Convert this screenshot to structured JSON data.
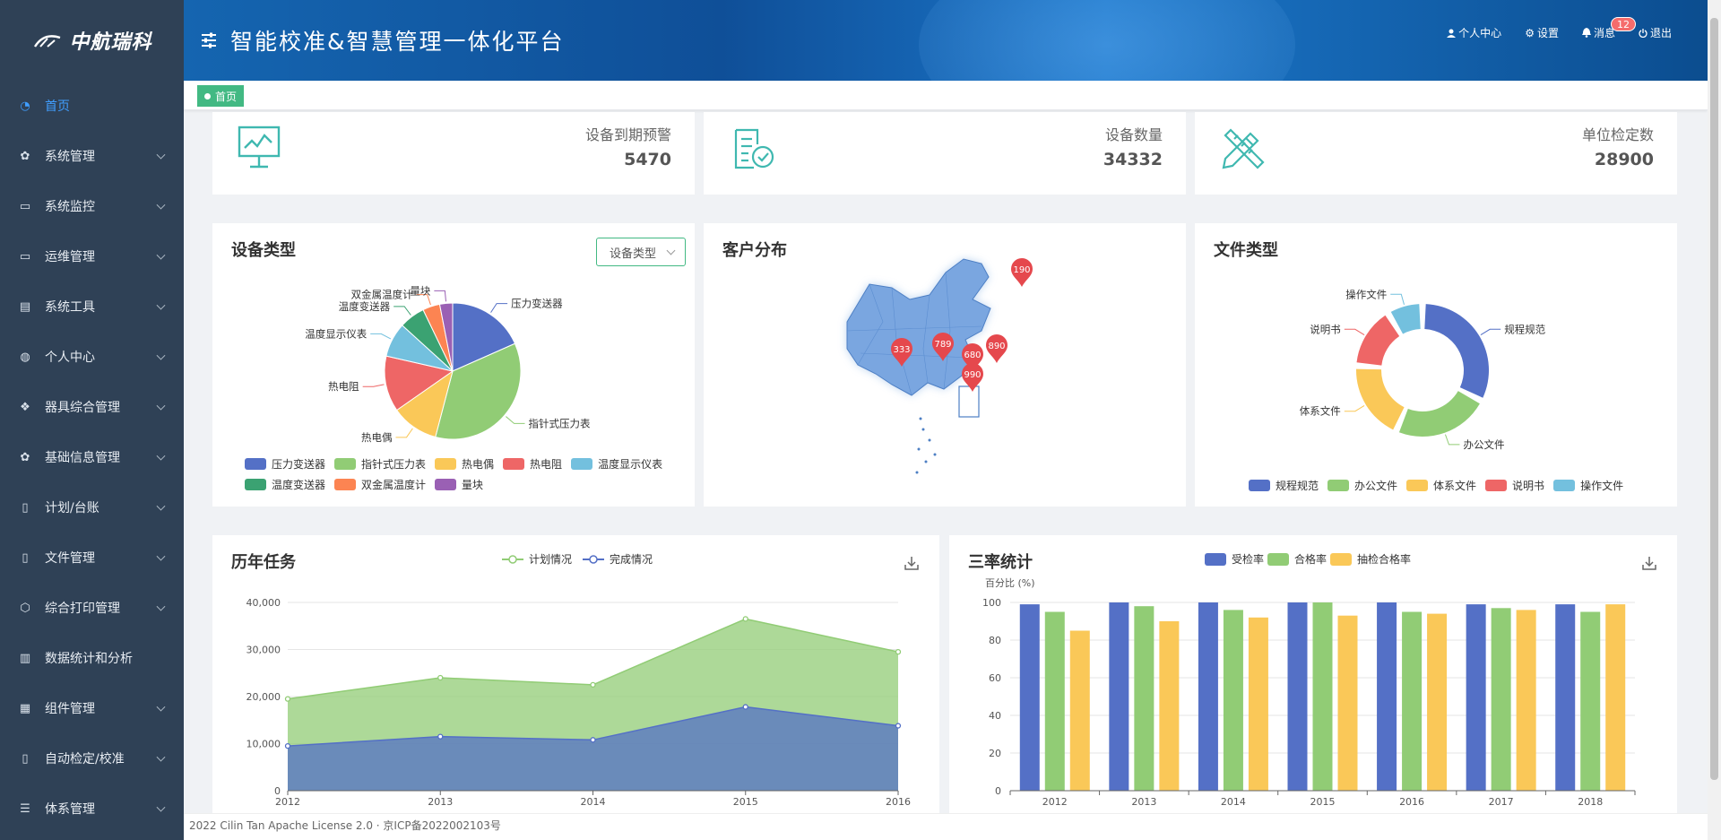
{
  "app": {
    "logo_text": "中航瑞科",
    "title": "智能校准&智慧管理一体化平台"
  },
  "toolbar": {
    "profile": "个人中心",
    "settings": "设置",
    "messages": "消息",
    "message_count": "12",
    "logout": "退出"
  },
  "tags": {
    "home": "首页"
  },
  "sidebar": {
    "items": [
      {
        "label": "首页",
        "icon": "dashboard-icon",
        "active": true
      },
      {
        "label": "系统管理",
        "icon": "gear-icon"
      },
      {
        "label": "系统监控",
        "icon": "monitor-icon"
      },
      {
        "label": "运维管理",
        "icon": "screen-icon"
      },
      {
        "label": "系统工具",
        "icon": "toolbox-icon"
      },
      {
        "label": "个人中心",
        "icon": "user-icon"
      },
      {
        "label": "器具综合管理",
        "icon": "grid-icon"
      },
      {
        "label": "基础信息管理",
        "icon": "gear-icon"
      },
      {
        "label": "计划/台账",
        "icon": "book-icon"
      },
      {
        "label": "文件管理",
        "icon": "book-icon"
      },
      {
        "label": "综合打印管理",
        "icon": "cube-icon"
      },
      {
        "label": "数据统计和分析",
        "icon": "bar-chart-icon"
      },
      {
        "label": "组件管理",
        "icon": "widgets-icon"
      },
      {
        "label": "自动检定/校准",
        "icon": "book-icon"
      },
      {
        "label": "体系管理",
        "icon": "list-icon"
      }
    ]
  },
  "stats": [
    {
      "label": "设备到期预警",
      "value": "5470",
      "icon": "monitor-chart-icon"
    },
    {
      "label": "设备数量",
      "value": "34332",
      "icon": "clipboard-check-icon"
    },
    {
      "label": "单位检定数",
      "value": "28900",
      "icon": "pencil-ruler-icon"
    }
  ],
  "panels": {
    "device_type": {
      "title": "设备类型",
      "select": "设备类型"
    },
    "customer": {
      "title": "客户分布"
    },
    "file_type": {
      "title": "文件类型"
    },
    "history": {
      "title": "历年任务"
    },
    "rates": {
      "title": "三率统计"
    }
  },
  "colors": {
    "blue": "#5470c6",
    "green": "#91cc75",
    "yellow": "#fac858",
    "red": "#ee6666",
    "cyan": "#73c0de",
    "teal": "#3ba272",
    "orange": "#fc8452",
    "purple": "#9a60b4",
    "accent": "#42b983",
    "sidebar": "#2f4156"
  },
  "chart_data": [
    {
      "type": "pie",
      "title": "设备类型",
      "categories": [
        "压力变送器",
        "指针式压力表",
        "热电偶",
        "热电阻",
        "温度显示仪表",
        "温度变送器",
        "双金属温度计",
        "量块"
      ],
      "values": [
        18,
        35,
        11,
        13,
        8,
        6,
        4,
        3
      ],
      "colors": [
        "#5470c6",
        "#91cc75",
        "#fac858",
        "#ee6666",
        "#73c0de",
        "#3ba272",
        "#fc8452",
        "#9a60b4"
      ],
      "legend": "bottom"
    },
    {
      "type": "map",
      "title": "客户分布",
      "markers": [
        "190",
        "333",
        "789",
        "680",
        "890",
        "990"
      ]
    },
    {
      "type": "pie",
      "subtype": "donut",
      "title": "文件类型",
      "categories": [
        "规程规范",
        "办公文件",
        "体系文件",
        "说明书",
        "操作文件"
      ],
      "values": [
        30,
        22,
        18,
        14,
        8
      ],
      "colors": [
        "#5470c6",
        "#91cc75",
        "#fac858",
        "#ee6666",
        "#73c0de"
      ],
      "legend": "bottom"
    },
    {
      "type": "area",
      "title": "历年任务",
      "x": [
        "2012",
        "2013",
        "2014",
        "2015",
        "2016"
      ],
      "series": [
        {
          "name": "计划情况",
          "values": [
            19500,
            24000,
            22500,
            36500,
            29500
          ],
          "color": "#91cc75"
        },
        {
          "name": "完成情况",
          "values": [
            9500,
            11500,
            10800,
            17800,
            13800
          ],
          "color": "#5470c6"
        }
      ],
      "ylim": [
        0,
        40000
      ],
      "yticks": [
        "0",
        "10,000",
        "20,000",
        "30,000",
        "40,000"
      ],
      "legend": "top-center"
    },
    {
      "type": "bar",
      "title": "三率统计",
      "ylabel": "百分比 (%)",
      "categories": [
        "2012",
        "2013",
        "2014",
        "2015",
        "2016",
        "2017",
        "2018"
      ],
      "series": [
        {
          "name": "受检率",
          "values": [
            99,
            100,
            100,
            100,
            100,
            99,
            99
          ],
          "color": "#5470c6"
        },
        {
          "name": "合格率",
          "values": [
            95,
            98,
            96,
            100,
            95,
            97,
            95
          ],
          "color": "#91cc75"
        },
        {
          "name": "抽检合格率",
          "values": [
            85,
            90,
            92,
            93,
            94,
            96,
            99
          ],
          "color": "#fac858"
        }
      ],
      "ylim": [
        0,
        100
      ],
      "yticks": [
        "0",
        "20",
        "40",
        "60",
        "80",
        "100"
      ],
      "legend": "top-center"
    }
  ],
  "footer": "2022 Cilin Tan Apache License 2.0 · 京ICP备2022002103号"
}
